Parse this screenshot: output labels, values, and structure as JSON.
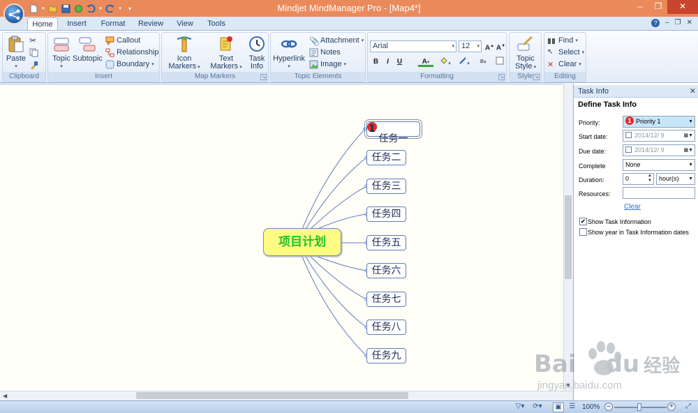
{
  "window": {
    "title": "Mindjet MindManager Pro - [Map4*]",
    "controls": [
      "–",
      "❐",
      "✕"
    ]
  },
  "quick_access": {
    "icons": [
      "new-file-icon",
      "open-icon",
      "save-icon",
      "publish-icon",
      "undo-icon",
      "redo-icon",
      "customize-icon"
    ]
  },
  "tabs": [
    {
      "label": "Home",
      "active": true
    },
    {
      "label": "Insert"
    },
    {
      "label": "Format"
    },
    {
      "label": "Review"
    },
    {
      "label": "View"
    },
    {
      "label": "Tools"
    }
  ],
  "ribbon": {
    "clipboard": {
      "title": "Clipboard",
      "paste": "Paste"
    },
    "insert": {
      "title": "Insert",
      "topic": "Topic",
      "subtopic": "Subtopic",
      "callout": "Callout",
      "relationship": "Relationship",
      "boundary": "Boundary"
    },
    "map_markers": {
      "title": "Map Markers",
      "icon_markers_1": "Icon",
      "icon_markers_2": "Markers",
      "text_markers_1": "Text",
      "text_markers_2": "Markers",
      "task_info_1": "Task",
      "task_info_2": "Info"
    },
    "topic_elements": {
      "title": "Topic Elements",
      "hyperlink": "Hyperlink",
      "attachment": "Attachment",
      "notes": "Notes",
      "image": "Image"
    },
    "formatting": {
      "title": "Formatting",
      "font": "Arial",
      "size": "12",
      "bold": "B",
      "italic": "I",
      "underline": "U"
    },
    "style": {
      "title": "Style",
      "topic_style_1": "Topic",
      "topic_style_2": "Style"
    },
    "editing": {
      "title": "Editing",
      "find": "Find",
      "select": "Select",
      "clear": "Clear"
    }
  },
  "map": {
    "central": "项目计划",
    "topics": [
      "任务一",
      "任务二",
      "任务三",
      "任务四",
      "任务五",
      "任务六",
      "任务七",
      "任务八",
      "任务九"
    ],
    "selected_priority": "1",
    "colors": {
      "central_fill": "#fffb82",
      "central_text": "#22c22a",
      "line": "#5d7cbc"
    }
  },
  "task_pane": {
    "title": "Task Info",
    "subtitle": "Define Task Info",
    "priority_label": "Priority:",
    "priority_value": "Priority 1",
    "priority_badge": "1",
    "start_label": "Start date:",
    "start_value": "2014/12/  9",
    "due_label": "Due date:",
    "due_value": "2014/12/  9",
    "complete_label": "Complete",
    "complete_value": "None",
    "duration_label": "Duration:",
    "duration_value": "0",
    "duration_unit": "hour(s)",
    "resources_label": "Resources:",
    "resources_value": "",
    "clear_link": "Clear",
    "show_task_info": "Show Task Information",
    "show_task_info_checked": true,
    "show_year": "Show year in Task Information dates",
    "show_year_checked": false
  },
  "status": {
    "zoom": "100%",
    "zoom_level": 1.0
  },
  "watermark": {
    "brand": "Bai",
    "brand2": "du",
    "cn": "经验",
    "url": "jingyan.baidu.com"
  }
}
